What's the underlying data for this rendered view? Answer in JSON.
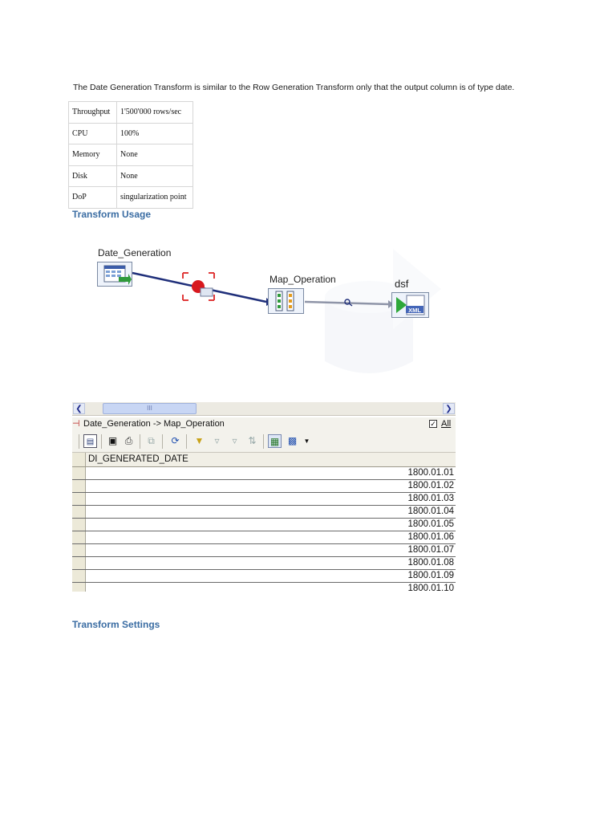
{
  "intro_text": "The Date Generation Transform is similar to the Row Generation Transform only that the output column is of type date.",
  "properties": [
    {
      "key": "Throughput",
      "value": "1'500'000 rows/sec"
    },
    {
      "key": "CPU",
      "value": "100%"
    },
    {
      "key": "Memory",
      "value": "None"
    },
    {
      "key": "Disk",
      "value": "None"
    },
    {
      "key": "DoP",
      "value": "singularization point"
    }
  ],
  "usage_heading": "Transform Usage",
  "diagram": {
    "source_label": "Date_Generation",
    "transform_label": "Map_Operation",
    "target_label": "dsf",
    "target_badge": "XML"
  },
  "viewer": {
    "scroll_thumb": "III",
    "title": "Date_Generation -> Map_Operation",
    "all_label": "All",
    "all_checked": true,
    "column_header": "DI_GENERATED_DATE",
    "rows": [
      "1800.01.01",
      "1800.01.02",
      "1800.01.03",
      "1800.01.04",
      "1800.01.05",
      "1800.01.06",
      "1800.01.07",
      "1800.01.08",
      "1800.01.09",
      "1800.01.10"
    ]
  },
  "settings_heading": "Transform Settings",
  "colors": {
    "heading": "#3b6da3",
    "link_line": "#1f2f7a"
  }
}
